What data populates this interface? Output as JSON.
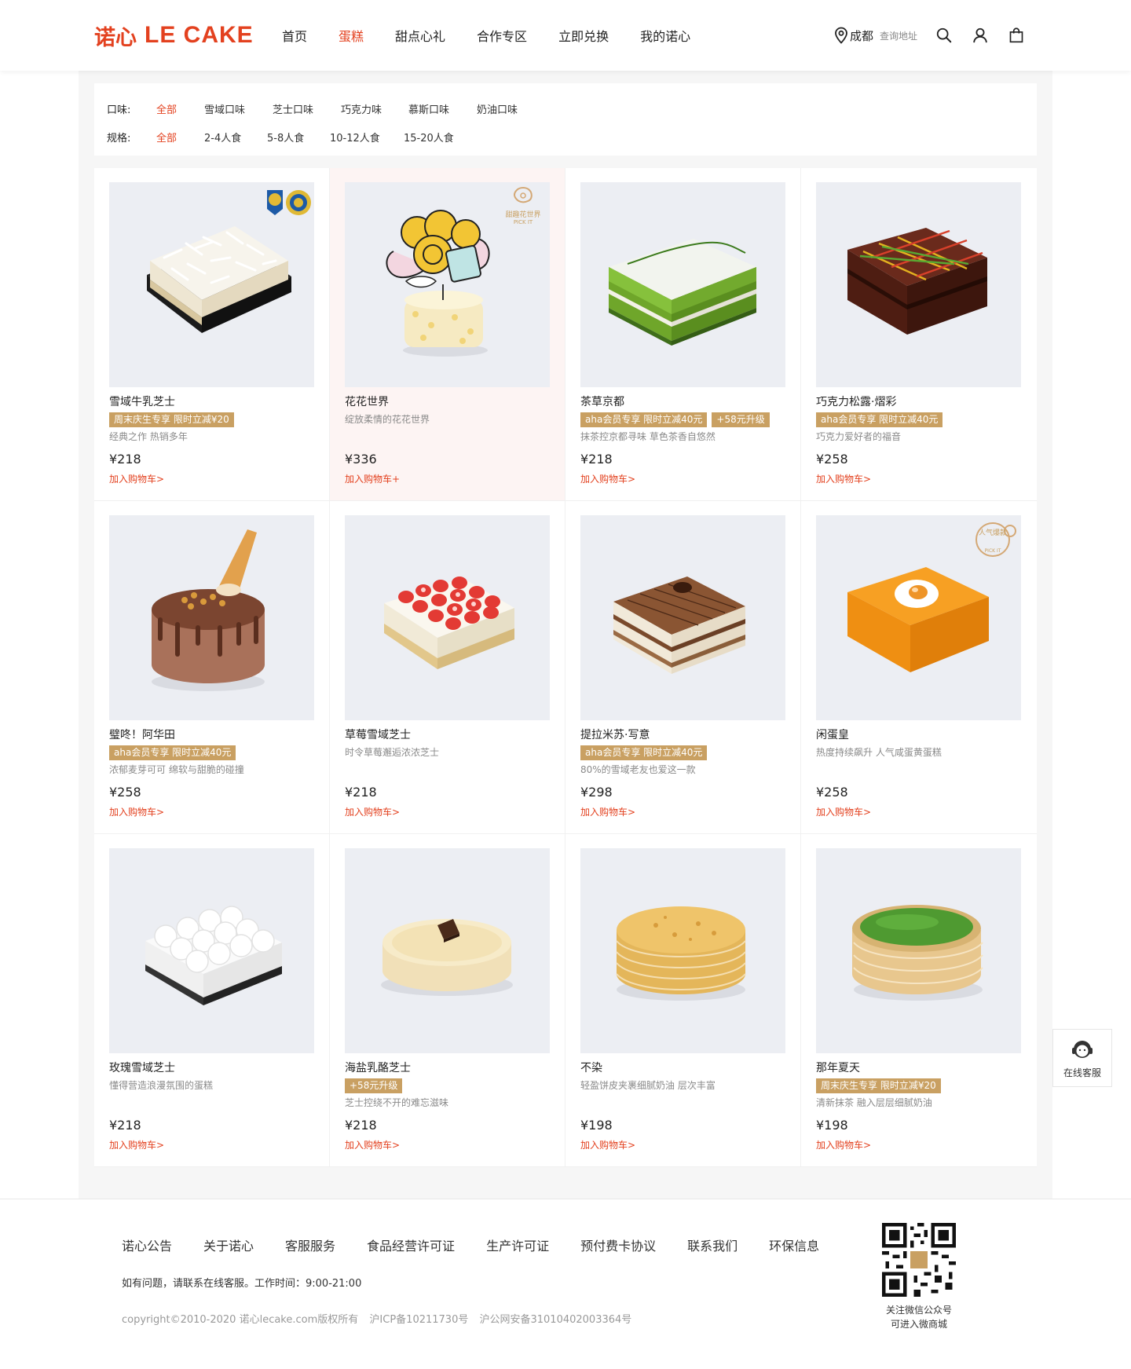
{
  "header": {
    "logo_cn": "诺心",
    "logo_en": "LE CAKE",
    "nav": [
      {
        "label": "首页",
        "active": false
      },
      {
        "label": "蛋糕",
        "active": true
      },
      {
        "label": "甜点心礼",
        "active": false
      },
      {
        "label": "合作专区",
        "active": false
      },
      {
        "label": "立即兑换",
        "active": false
      },
      {
        "label": "我的诺心",
        "active": false
      }
    ],
    "city": "成都",
    "address_hint": "查询地址",
    "icons": [
      "location-pin-icon",
      "search-icon",
      "user-icon",
      "shopping-bag-icon"
    ]
  },
  "filters": {
    "flavor": {
      "label": "口味:",
      "options": [
        "全部",
        "雪域口味",
        "芝士口味",
        "巧克力味",
        "慕斯口味",
        "奶油口味"
      ],
      "active": "全部"
    },
    "size": {
      "label": "规格:",
      "options": [
        "全部",
        "2-4人食",
        "5-8人食",
        "10-12人食",
        "15-20人食"
      ],
      "active": "全部"
    }
  },
  "products": [
    {
      "name": "雪域牛乳芝士",
      "tags": [
        "周末庆生专享 限时立减¥20"
      ],
      "desc": "经典之作 热销多年",
      "price": "¥218",
      "cart": "加入购物车>",
      "badge": "award-badges-icon"
    },
    {
      "name": "花花世界",
      "tags": [],
      "desc": "绽放柔情的花花世界",
      "price": "¥336",
      "cart": "加入购物车+",
      "badge": "tiantian-flower-world-stamp-icon",
      "stamp": "甜趣花世界",
      "stamp_sub": "PICK IT"
    },
    {
      "name": "茶草京都",
      "tags": [
        "aha会员专享 限时立减40元",
        "+58元升级"
      ],
      "desc": "抹茶控京都寻味 草色茶香自悠然",
      "price": "¥218",
      "cart": "加入购物车>"
    },
    {
      "name": "巧克力松露·熠彩",
      "tags": [
        "aha会员专享 限时立减40元"
      ],
      "desc": "巧克力爱好者的福音",
      "price": "¥258",
      "cart": "加入购物车>"
    },
    {
      "name": "璧咚！阿华田",
      "tags": [
        "aha会员专享 限时立减40元"
      ],
      "desc": "浓郁麦芽可可 绵软与甜脆的碰撞",
      "price": "¥258",
      "cart": "加入购物车>"
    },
    {
      "name": "草莓雪域芝士",
      "tags": [],
      "desc": "时令草莓邂逅浓浓芝士",
      "price": "¥218",
      "cart": "加入购物车>"
    },
    {
      "name": "提拉米苏·写意",
      "tags": [
        "aha会员专享 限时立减40元"
      ],
      "desc": "80%的雪域老友也爱这一款",
      "price": "¥298",
      "cart": "加入购物车>"
    },
    {
      "name": "闲蛋皇",
      "tags": [],
      "desc": "热度持续飙升 人气咸蛋黄蛋糕",
      "price": "¥258",
      "cart": "加入购物车>",
      "badge": "popular-stamp-icon",
      "stamp": "人气爆款",
      "stamp_sub": "PICK IT"
    },
    {
      "name": "玫瑰雪域芝士",
      "tags": [],
      "desc": "懂得营造浪漫氛围的蛋糕",
      "price": "¥218",
      "cart": "加入购物车>"
    },
    {
      "name": "海盐乳酪芝士",
      "tags": [
        "+58元升级"
      ],
      "desc": "芝士控绕不开的难忘滋味",
      "price": "¥218",
      "cart": "加入购物车>"
    },
    {
      "name": "不染",
      "tags": [],
      "desc": "轻盈饼皮夹裹细腻奶油 层次丰富",
      "price": "¥198",
      "cart": "加入购物车>"
    },
    {
      "name": "那年夏天",
      "tags": [
        "周末庆生专享 限时立减¥20"
      ],
      "desc": "清新抹茶 融入层层细腻奶油",
      "price": "¥198",
      "cart": "加入购物车>"
    }
  ],
  "service": {
    "label": "在线客服",
    "icon": "customer-service-icon"
  },
  "footer": {
    "links": [
      "诺心公告",
      "关于诺心",
      "客服服务",
      "食品经营许可证",
      "生产许可证",
      "预付费卡协议",
      "联系我们",
      "环保信息"
    ],
    "contact": "如有问题，请联系在线客服。工作时间：9:00-21:00",
    "copyright": [
      "copyright©2010-2020 诺心lecake.com版权所有",
      "沪ICP备10211730号",
      "沪公网安备31010402003364号"
    ],
    "qr_text_1": "关注微信公众号",
    "qr_text_2": "可进入微商城"
  },
  "colors": {
    "accent": "#e3411f",
    "tag": "#c9a062",
    "page_bg": "#f6f6f6"
  }
}
